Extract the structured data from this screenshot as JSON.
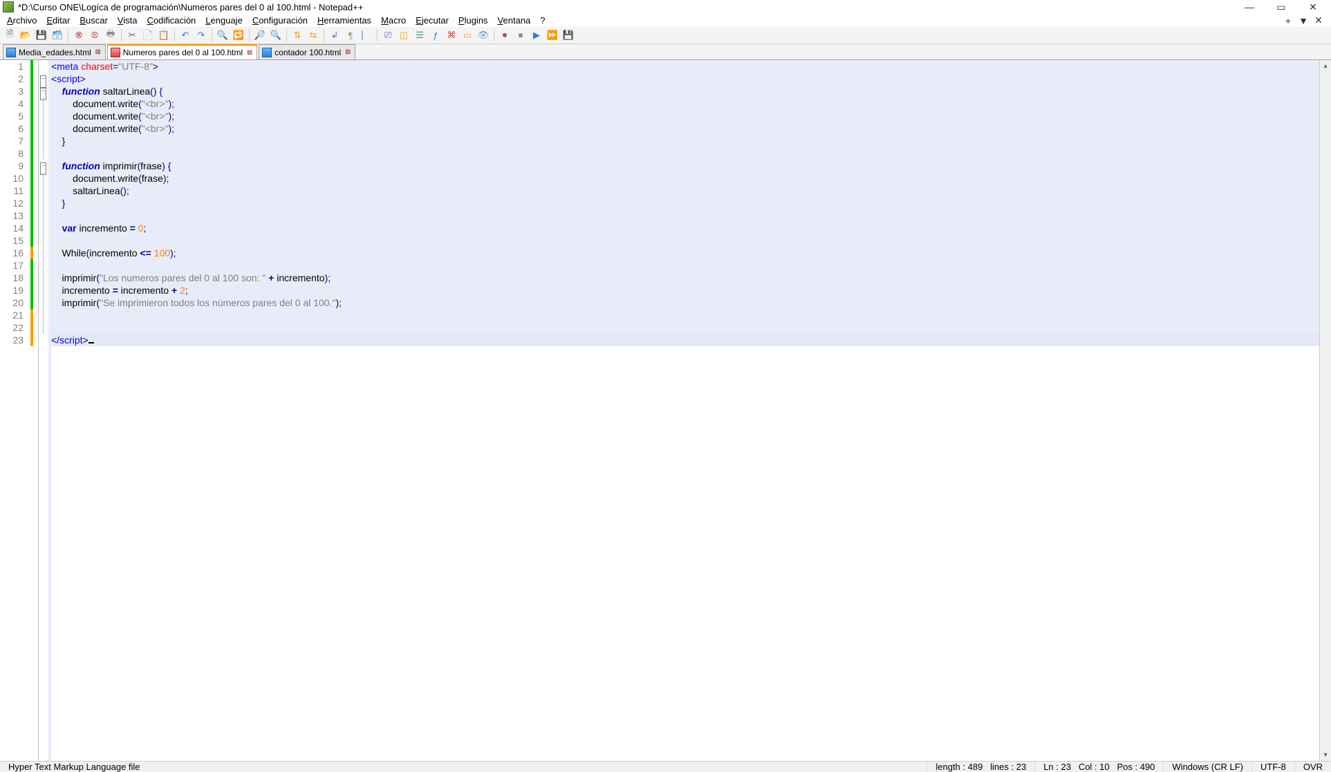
{
  "titlebar": {
    "title": "*D:\\Curso ONE\\Logíca de programación\\Numeros pares del 0 al 100.html - Notepad++"
  },
  "menu": {
    "archivo": "Archivo",
    "editar": "Editar",
    "buscar": "Buscar",
    "vista": "Vista",
    "codificacion": "Codificación",
    "lenguaje": "Lenguaje",
    "configuracion": "Configuración",
    "herramientas": "Herramientas",
    "macro": "Macro",
    "ejecutar": "Ejecutar",
    "plugins": "Plugins",
    "ventana": "Ventana",
    "help": "?"
  },
  "tabs": [
    {
      "label": "Media_edades.html",
      "modified": false,
      "active": false
    },
    {
      "label": "Numeros pares del 0 al 100.html",
      "modified": true,
      "active": true
    },
    {
      "label": "contador 100.html",
      "modified": false,
      "active": false
    }
  ],
  "code": {
    "lines": [
      {
        "n": 1,
        "mark": "green",
        "fold": "",
        "tokens": [
          [
            "pun",
            "<"
          ],
          [
            "tag",
            "meta"
          ],
          [
            "id",
            " "
          ],
          [
            "attr",
            "charset"
          ],
          [
            "pun",
            "="
          ],
          [
            "str",
            "\"UTF-8\""
          ],
          [
            "pun",
            ">"
          ]
        ]
      },
      {
        "n": 2,
        "mark": "green",
        "fold": "box",
        "tokens": [
          [
            "pun",
            "<"
          ],
          [
            "tag",
            "script"
          ],
          [
            "pun",
            ">"
          ]
        ]
      },
      {
        "n": 3,
        "mark": "green",
        "fold": "box",
        "tokens": [
          [
            "id",
            "    "
          ],
          [
            "kw",
            "function"
          ],
          [
            "id",
            " saltarLinea"
          ],
          [
            "pun",
            "()"
          ],
          [
            "id",
            " "
          ],
          [
            "pun",
            "{"
          ]
        ]
      },
      {
        "n": 4,
        "mark": "green",
        "fold": "line",
        "tokens": [
          [
            "id",
            "        document"
          ],
          [
            "pun",
            "."
          ],
          [
            "id",
            "write"
          ],
          [
            "pun",
            "("
          ],
          [
            "str",
            "\"<br>\""
          ],
          [
            "pun",
            ");"
          ]
        ]
      },
      {
        "n": 5,
        "mark": "green",
        "fold": "line",
        "tokens": [
          [
            "id",
            "        document"
          ],
          [
            "pun",
            "."
          ],
          [
            "id",
            "write"
          ],
          [
            "pun",
            "("
          ],
          [
            "str",
            "\"<br>\""
          ],
          [
            "pun",
            ");"
          ]
        ]
      },
      {
        "n": 6,
        "mark": "green",
        "fold": "line",
        "tokens": [
          [
            "id",
            "        document"
          ],
          [
            "pun",
            "."
          ],
          [
            "id",
            "write"
          ],
          [
            "pun",
            "("
          ],
          [
            "str",
            "\"<br>\""
          ],
          [
            "pun",
            ");"
          ]
        ]
      },
      {
        "n": 7,
        "mark": "green",
        "fold": "line",
        "tokens": [
          [
            "id",
            "    "
          ],
          [
            "pun",
            "}"
          ]
        ]
      },
      {
        "n": 8,
        "mark": "green",
        "fold": "line",
        "tokens": [
          [
            "id",
            ""
          ]
        ]
      },
      {
        "n": 9,
        "mark": "green",
        "fold": "box",
        "tokens": [
          [
            "id",
            "    "
          ],
          [
            "kw",
            "function"
          ],
          [
            "id",
            " imprimir"
          ],
          [
            "pun",
            "("
          ],
          [
            "id",
            "frase"
          ],
          [
            "pun",
            ")"
          ],
          [
            "id",
            " "
          ],
          [
            "pun",
            "{"
          ]
        ]
      },
      {
        "n": 10,
        "mark": "green",
        "fold": "line",
        "tokens": [
          [
            "id",
            "        document"
          ],
          [
            "pun",
            "."
          ],
          [
            "id",
            "write"
          ],
          [
            "pun",
            "("
          ],
          [
            "id",
            "frase"
          ],
          [
            "pun",
            ");"
          ]
        ]
      },
      {
        "n": 11,
        "mark": "green",
        "fold": "line",
        "tokens": [
          [
            "id",
            "        saltarLinea"
          ],
          [
            "pun",
            "();"
          ]
        ]
      },
      {
        "n": 12,
        "mark": "green",
        "fold": "line",
        "tokens": [
          [
            "id",
            "    "
          ],
          [
            "pun",
            "}"
          ]
        ]
      },
      {
        "n": 13,
        "mark": "green",
        "fold": "line",
        "tokens": [
          [
            "id",
            ""
          ]
        ]
      },
      {
        "n": 14,
        "mark": "green",
        "fold": "line",
        "tokens": [
          [
            "id",
            "    "
          ],
          [
            "var",
            "var"
          ],
          [
            "id",
            " incremento "
          ],
          [
            "op",
            "="
          ],
          [
            "id",
            " "
          ],
          [
            "num",
            "0"
          ],
          [
            "pun",
            ";"
          ]
        ]
      },
      {
        "n": 15,
        "mark": "green",
        "fold": "line",
        "tokens": [
          [
            "id",
            ""
          ]
        ]
      },
      {
        "n": 16,
        "mark": "orange",
        "fold": "line",
        "tokens": [
          [
            "id",
            "    While"
          ],
          [
            "pun",
            "("
          ],
          [
            "id",
            "incremento "
          ],
          [
            "op",
            "<="
          ],
          [
            "id",
            " "
          ],
          [
            "num",
            "100"
          ],
          [
            "pun",
            ");"
          ]
        ]
      },
      {
        "n": 17,
        "mark": "green",
        "fold": "line",
        "tokens": [
          [
            "id",
            ""
          ]
        ]
      },
      {
        "n": 18,
        "mark": "green",
        "fold": "line",
        "tokens": [
          [
            "id",
            "    imprimir"
          ],
          [
            "pun",
            "("
          ],
          [
            "str",
            "\"Los numeros pares del 0 al 100 son: \""
          ],
          [
            "id",
            " "
          ],
          [
            "op",
            "+"
          ],
          [
            "id",
            " incremento"
          ],
          [
            "pun",
            ");"
          ]
        ]
      },
      {
        "n": 19,
        "mark": "green",
        "fold": "line",
        "tokens": [
          [
            "id",
            "    incremento "
          ],
          [
            "op",
            "="
          ],
          [
            "id",
            " incremento "
          ],
          [
            "op",
            "+"
          ],
          [
            "id",
            " "
          ],
          [
            "num",
            "2"
          ],
          [
            "pun",
            ";"
          ]
        ]
      },
      {
        "n": 20,
        "mark": "green",
        "fold": "line",
        "tokens": [
          [
            "id",
            "    imprimir"
          ],
          [
            "pun",
            "("
          ],
          [
            "str",
            "\"Se imprimieron todos los números pares del 0 al 100.\""
          ],
          [
            "pun",
            ");"
          ]
        ]
      },
      {
        "n": 21,
        "mark": "orange",
        "fold": "line",
        "tokens": [
          [
            "id",
            ""
          ]
        ]
      },
      {
        "n": 22,
        "mark": "orange",
        "fold": "line",
        "tokens": [
          [
            "id",
            ""
          ]
        ]
      },
      {
        "n": 23,
        "mark": "orange",
        "fold": "",
        "tokens": [
          [
            "pun",
            "</"
          ],
          [
            "tag",
            "script"
          ],
          [
            "pun",
            ">"
          ]
        ],
        "caret": true
      }
    ]
  },
  "status": {
    "filetype": "Hyper Text Markup Language file",
    "length": "length : 489",
    "lines": "lines : 23",
    "ln": "Ln : 23",
    "col": "Col : 10",
    "pos": "Pos : 490",
    "eol": "Windows (CR LF)",
    "encoding": "UTF-8",
    "ins": "OVR"
  }
}
